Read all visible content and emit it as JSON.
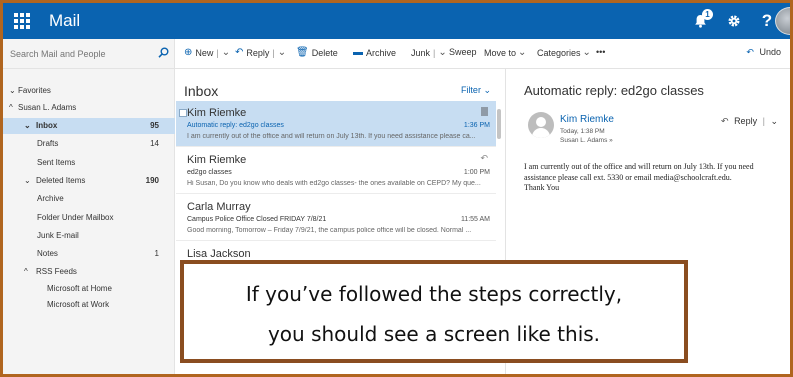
{
  "topbar": {
    "app_title": "Mail",
    "notification_count": "1",
    "help_label": "?"
  },
  "search": {
    "placeholder": "Search Mail and People"
  },
  "commands": {
    "new": "New",
    "reply": "Reply",
    "delete": "Delete",
    "archive": "Archive",
    "junk": "Junk",
    "sweep": "Sweep",
    "move_to": "Move to",
    "categories": "Categories",
    "more": "•••",
    "undo": "Undo"
  },
  "folders": {
    "favorites": "Favorites",
    "account": "Susan L. Adams",
    "items": [
      {
        "label": "Inbox",
        "count": "95"
      },
      {
        "label": "Drafts",
        "count": "14"
      },
      {
        "label": "Sent Items",
        "count": ""
      },
      {
        "label": "Deleted Items",
        "count": "190"
      },
      {
        "label": "Archive",
        "count": ""
      },
      {
        "label": "Folder Under Mailbox",
        "count": ""
      },
      {
        "label": "Junk E-mail",
        "count": ""
      },
      {
        "label": "Notes",
        "count": "1"
      },
      {
        "label": "RSS Feeds",
        "count": ""
      },
      {
        "label": "Microsoft at Home",
        "count": ""
      },
      {
        "label": "Microsoft at Work",
        "count": ""
      }
    ]
  },
  "list": {
    "title": "Inbox",
    "filter": "Filter",
    "messages": [
      {
        "sender": "Kim Riemke",
        "subject": "Automatic reply: ed2go classes",
        "time": "1:36 PM",
        "preview": "I am currently out of the office and will return on July 13th. If you need assistance please ca..."
      },
      {
        "sender": "Kim Riemke",
        "subject": "ed2go classes",
        "time": "1:00 PM",
        "preview": "Hi Susan, Do you know who deals with ed2go classes- the ones available on CEPD? My que..."
      },
      {
        "sender": "Carla Murray",
        "subject": "Campus Police Office Closed FRIDAY 7/8/21",
        "time": "11:55 AM",
        "preview": "Good morning, Tomorrow – Friday 7/9/21, the campus police office will be closed. Normal ..."
      },
      {
        "sender": "Lisa Jackson",
        "subject": "",
        "time": "",
        "preview": ""
      }
    ]
  },
  "reading": {
    "title": "Automatic reply: ed2go classes",
    "sender": "Kim Riemke",
    "date": "Today, 1:38 PM",
    "to": "Susan L. Adams »",
    "reply": "Reply",
    "body_line1": "I am currently out of the office and will return on July 13th. If you need",
    "body_line2": "assistance please call ext. 5330 or email media@schoolcraft.edu.",
    "body_line3": "Thank You"
  },
  "caption": {
    "line1": "If you’ve followed the steps correctly,",
    "line2": "you should see a screen like this."
  }
}
